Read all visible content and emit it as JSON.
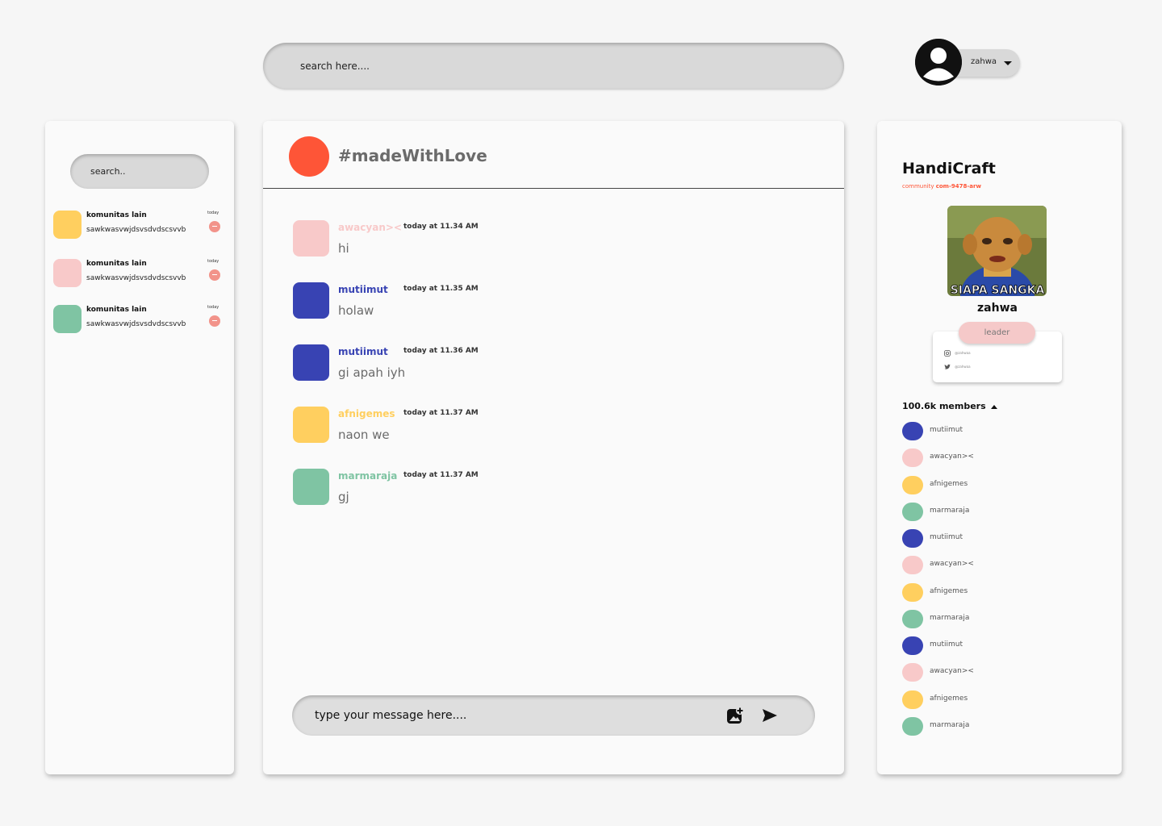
{
  "header": {
    "search_placeholder": "search here....",
    "user": {
      "name": "zahwa"
    }
  },
  "left": {
    "search_placeholder": "search..",
    "communities": [
      {
        "name": "komunitas lain",
        "last_message": "sawkwasvwjdsvsdvdscsvvb",
        "day": "today",
        "color": "#ffcf5f"
      },
      {
        "name": "komunitas lain",
        "last_message": "sawkwasvwjdsvsdvdscsvvb",
        "day": "today",
        "color": "#f8c9c9"
      },
      {
        "name": "komunitas lain",
        "last_message": "sawkwasvwjdsvsdvdscsvvb",
        "day": "today",
        "color": "#7fc4a3"
      }
    ]
  },
  "channel": {
    "title": "#madeWithLove",
    "color": "#fe5537",
    "messages": [
      {
        "author": "awacyan><",
        "time": "today at 11.34 AM",
        "text": "hi",
        "color": "#f8c9c9"
      },
      {
        "author": "mutiimut",
        "time": "today at 11.35 AM",
        "text": "holaw",
        "color": "#3843b3"
      },
      {
        "author": "mutiimut",
        "time": "today at 11.36 AM",
        "text": "gi apah iyh",
        "color": "#3843b3"
      },
      {
        "author": "afnigemes",
        "time": "today at 11.37 AM",
        "text": "naon we",
        "color": "#ffcf5f"
      },
      {
        "author": "marmaraja",
        "time": "today at 11.37 AM",
        "text": "gj",
        "color": "#7fc4a3"
      }
    ],
    "compose_placeholder": "type your message here...."
  },
  "community": {
    "name": "HandiCraft",
    "id_label": "community",
    "id": "com-9478-arw",
    "profile_caption": "SIAPA SANGKA",
    "profile_name": "zahwa",
    "role": "leader",
    "socials": [
      {
        "icon": "instagram-icon",
        "handle": "@zahwaa"
      },
      {
        "icon": "twitter-icon",
        "handle": "@zahwaa"
      }
    ],
    "members_count": "100.6k members",
    "members": [
      {
        "name": "mutiimut",
        "color": "#3843b3"
      },
      {
        "name": "awacyan><",
        "color": "#f8c9c9"
      },
      {
        "name": "afnigemes",
        "color": "#ffcf5f"
      },
      {
        "name": "marmaraja",
        "color": "#7fc4a3"
      },
      {
        "name": "mutiimut",
        "color": "#3843b3"
      },
      {
        "name": "awacyan><",
        "color": "#f8c9c9"
      },
      {
        "name": "afnigemes",
        "color": "#ffcf5f"
      },
      {
        "name": "marmaraja",
        "color": "#7fc4a3"
      },
      {
        "name": "mutiimut",
        "color": "#3843b3"
      },
      {
        "name": "awacyan><",
        "color": "#f8c9c9"
      },
      {
        "name": "afnigemes",
        "color": "#ffcf5f"
      },
      {
        "name": "marmaraja",
        "color": "#7fc4a3"
      }
    ]
  }
}
